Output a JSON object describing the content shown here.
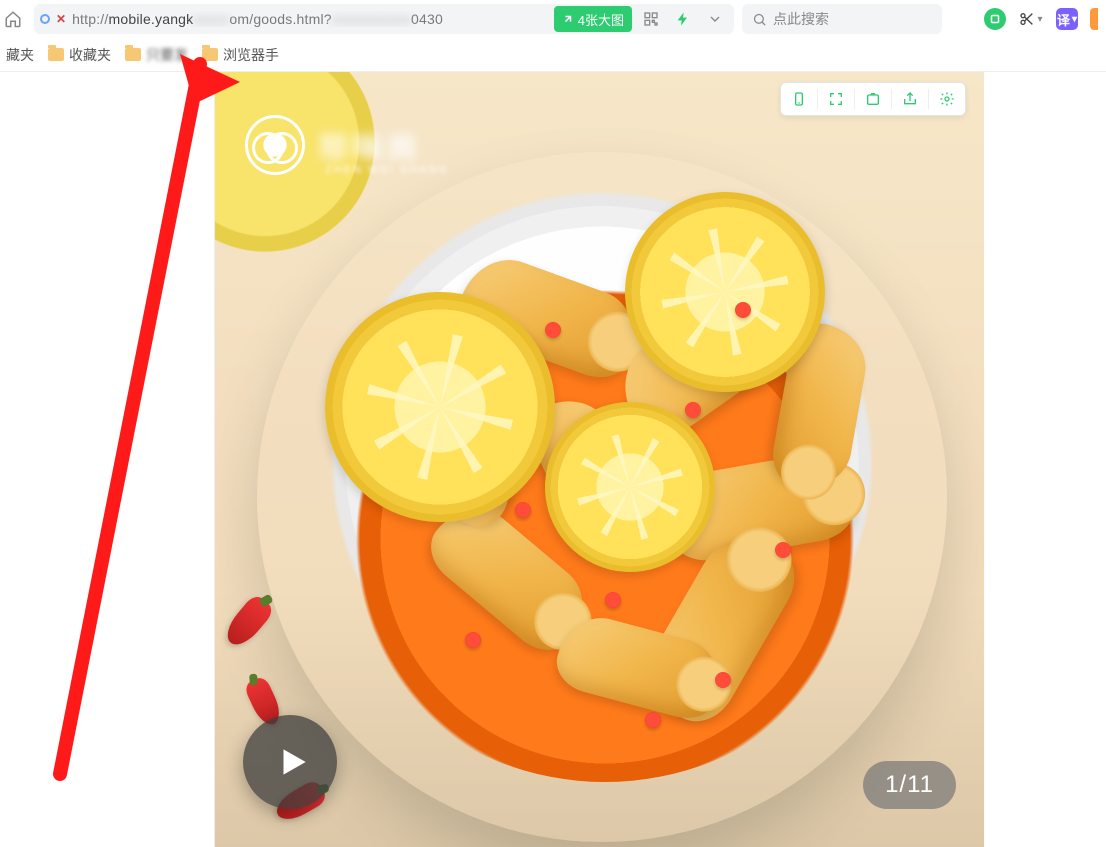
{
  "addr": {
    "url_prefix": "http://",
    "url_host_visible": "mobile.yangk",
    "url_host_blur": "xxxxx",
    "url_host_tail": "om/goods.html?",
    "url_query_blur": "xxxxxxxxxxx",
    "url_query_tail": "0430",
    "big_image_badge": "4张大图"
  },
  "search": {
    "placeholder": "点此搜索"
  },
  "bookmarks": {
    "b1": "藏夹",
    "b2": "收藏夹",
    "b3_blur": "只要发",
    "b4": "浏览器手"
  },
  "right_icons": {
    "translate_glyph": "译"
  },
  "product": {
    "brand_blur": "珍味尚",
    "brand_sub_blur": "ZHEN WEI SHANG",
    "counter": "1/11"
  },
  "dev_toolbar": {
    "icons": [
      "mobile-icon",
      "expand-icon",
      "capture-icon",
      "share-icon",
      "gear-icon"
    ]
  }
}
